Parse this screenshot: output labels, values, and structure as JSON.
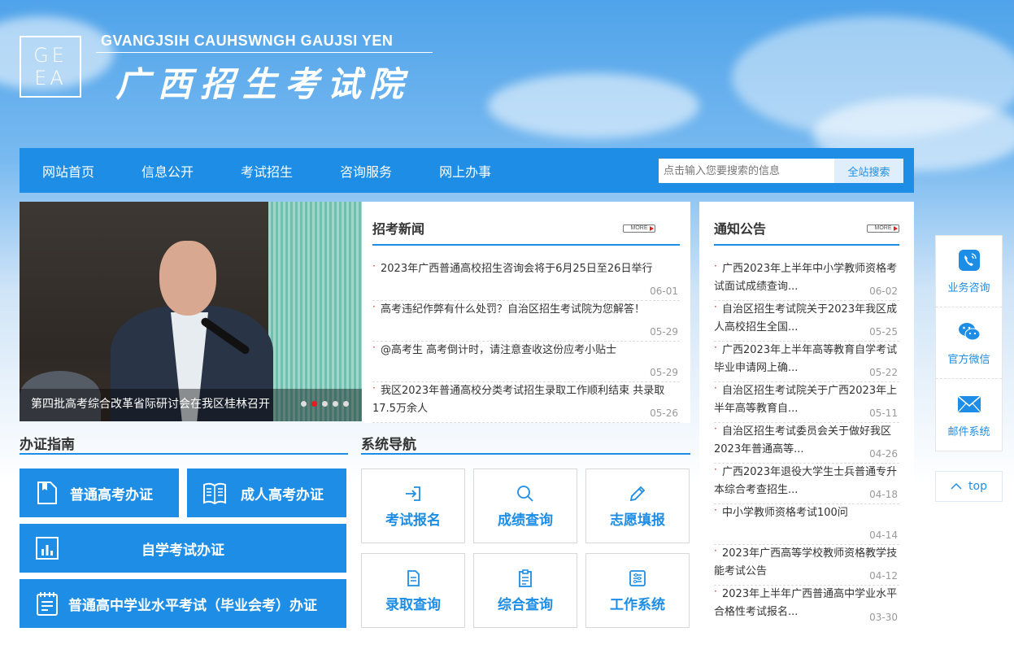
{
  "header": {
    "logo_rows": [
      "GE",
      "EA"
    ],
    "site_latin": "GVANGJSIH CAUHSWNGH GAUJSI YEN",
    "site_chinese": "广西招生考试院"
  },
  "nav": {
    "items": [
      "网站首页",
      "信息公开",
      "考试招生",
      "咨询服务",
      "网上办事"
    ],
    "search_placeholder": "点击输入您要搜索的信息",
    "search_button": "全站搜索"
  },
  "carousel": {
    "caption": "第四批高考综合改革省际研讨会在我区桂林召开",
    "dot_count": 5,
    "active_dot": 1
  },
  "recruit_news": {
    "title": "招考新闻",
    "more": "MORE",
    "items": [
      {
        "title": "2023年广西普通高校招生咨询会将于6月25日至26日举行",
        "date": "06-01"
      },
      {
        "title": "高考违纪作弊有什么处罚？自治区招生考试院为您解答！",
        "date": "05-29"
      },
      {
        "title": "@高考生 高考倒计时，请注意查收这份应考小贴士",
        "date": "05-29"
      },
      {
        "title": "我区2023年普通高校分类考试招生录取工作顺利结束 共录取17.5万余人",
        "date": "05-26"
      }
    ]
  },
  "notices": {
    "title": "通知公告",
    "more": "MORE",
    "items": [
      {
        "title": "广西2023年上半年中小学教师资格考试面试成绩查询...",
        "date": "06-02"
      },
      {
        "title": "自治区招生考试院关于2023年我区成人高校招生全国...",
        "date": "05-25"
      },
      {
        "title": "广西2023年上半年高等教育自学考试毕业申请网上确...",
        "date": "05-22"
      },
      {
        "title": "自治区招生考试院关于广西2023年上半年高等教育自...",
        "date": "05-11"
      },
      {
        "title": "自治区招生考试委员会关于做好我区2023年普通高等...",
        "date": "04-26"
      },
      {
        "title": "广西2023年退役大学生士兵普通专升本综合考查招生...",
        "date": "04-18"
      },
      {
        "title": "中小学教师资格考试100问",
        "date": "04-14"
      },
      {
        "title": "2023年广西高等学校教师资格教学技能考试公告",
        "date": "04-12"
      },
      {
        "title": "2023年上半年广西普通高中学业水平合格性考试报名...",
        "date": "03-30"
      }
    ]
  },
  "cert_guide": {
    "title": "办证指南",
    "buttons": [
      "普通高考办证",
      "成人高考办证",
      "自学考试办证",
      "普通高中学业水平考试（毕业会考）办证"
    ]
  },
  "system_nav": {
    "title": "系统导航",
    "tiles": [
      "考试报名",
      "成绩查询",
      "志愿填报",
      "录取查询",
      "综合查询",
      "工作系统"
    ]
  },
  "side": {
    "items": [
      "业务咨询",
      "官方微信",
      "邮件系统"
    ],
    "top": "top"
  },
  "colors": {
    "primary": "#1e8de5",
    "bullet_red": "#e41e1e"
  }
}
